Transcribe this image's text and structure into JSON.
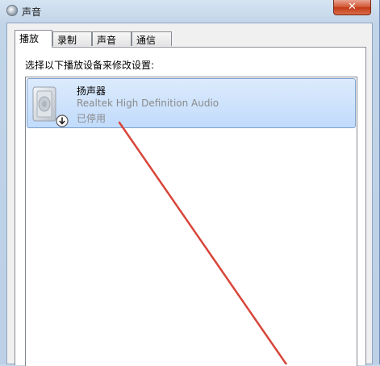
{
  "window": {
    "title": "声音",
    "close_glyph": "✕"
  },
  "tabs": [
    {
      "label": "播放",
      "active": true
    },
    {
      "label": "录制",
      "active": false
    },
    {
      "label": "声音",
      "active": false
    },
    {
      "label": "通信",
      "active": false
    }
  ],
  "playback": {
    "instruction": "选择以下播放设备来修改设置:",
    "devices": [
      {
        "name": "扬声器",
        "driver": "Realtek High Definition Audio",
        "status": "已停用",
        "icon": "speaker-icon",
        "status_icon": "disabled-arrow-icon",
        "selected": true
      }
    ]
  },
  "colors": {
    "selection_bg": "#c9dff9",
    "annotation_arrow": "#d23a2f",
    "close_button": "#c9472a"
  }
}
